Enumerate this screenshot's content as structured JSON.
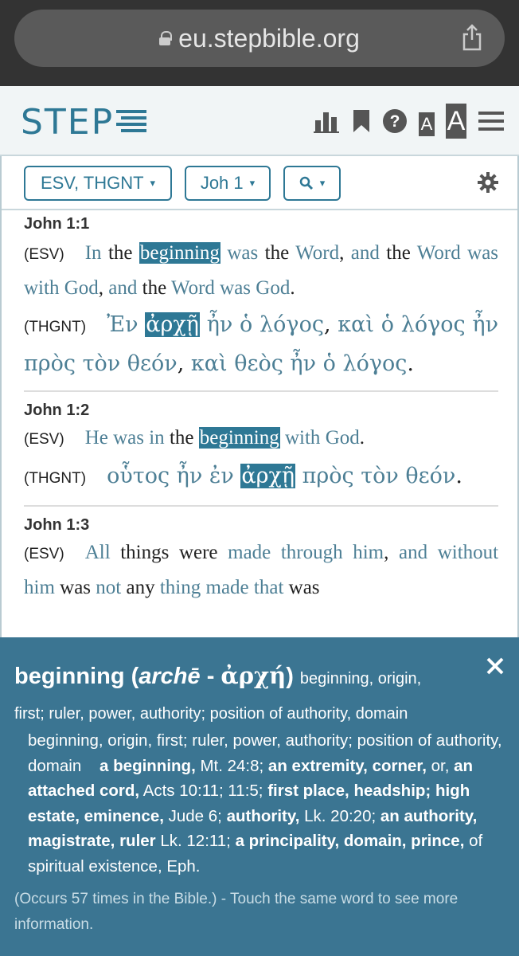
{
  "browser": {
    "url": "eu.stepbible.org"
  },
  "header": {
    "logo": "STEP",
    "icon_font_small": "A",
    "icon_font_large": "A"
  },
  "toolbar": {
    "versions": "ESV, THGNT",
    "passage": "Joh 1",
    "caret": "▾"
  },
  "verses": [
    {
      "ref": "John 1:1",
      "esv_label": "(ESV)",
      "thgnt_label": "(THGNT)"
    },
    {
      "ref": "John 1:2",
      "esv_label": "(ESV)",
      "thgnt_label": "(THGNT)"
    },
    {
      "ref": "John 1:3",
      "esv_label": "(ESV)"
    }
  ],
  "text": {
    "v1_esv": [
      "In",
      "the",
      "beginning",
      "was",
      "the",
      "Word",
      ",",
      "and",
      "the",
      "Word",
      "was",
      "with",
      "God",
      ",",
      "and",
      "the",
      "Word",
      "was",
      "God",
      "."
    ],
    "v1_gr": [
      "Ἐν",
      "ἀρχῇ",
      "ἦν",
      "ὁ",
      "λόγος",
      ",",
      "καὶ",
      "ὁ",
      "λόγος",
      "ἦν",
      "πρὸς",
      "τὸν",
      "θεόν",
      ",",
      "καὶ",
      "θεὸς",
      "ἦν",
      "ὁ",
      "λόγος",
      "."
    ],
    "v2_esv": [
      "He",
      "was",
      "in",
      "the",
      "beginning",
      "with",
      "God",
      "."
    ],
    "v2_gr": [
      "οὗτος",
      "ἦν",
      "ἐν",
      "ἀρχῇ",
      "πρὸς",
      "τὸν",
      "θεόν",
      "."
    ],
    "v3_esv": [
      "All",
      "things",
      "were",
      "made",
      "through",
      "him",
      ",",
      "and",
      "without",
      "him",
      "was",
      "not",
      "any",
      "thing",
      "made",
      "that",
      "was"
    ]
  },
  "lexicon": {
    "word": "beginning",
    "translit": "archē",
    "greek": "ἀρχή",
    "short_def": "beginning, origin,",
    "line1": "first; ruler, power, authority; position of authority, domain",
    "def_plain1": "beginning, origin, first; ruler, power, authority; position of authority, domain",
    "def_b1": "a beginning,",
    "def_t1": " Mt. 24:8; ",
    "def_b2": "an extremity, corner,",
    "def_t2": " or, ",
    "def_b3": "an attached cord,",
    "def_t3": " Acts 10:11; 11:5; ",
    "def_b4": "first place, headship; high estate, eminence,",
    "def_t4": " Jude 6; ",
    "def_b5": "authority,",
    "def_t5": " Lk. 20:20; ",
    "def_b6": "an authority, magistrate, ruler",
    "def_t6": " Lk. 12:11; ",
    "def_b7": "a principality, domain, prince,",
    "def_t7": " of spiritual existence, Eph.",
    "occurs": "(Occurs 57 times in the Bible.) - Touch the same word to see more information."
  },
  "colors": {
    "accent": "#2e7895",
    "word_link": "#4d7f95",
    "popup_bg": "#3b7592"
  }
}
